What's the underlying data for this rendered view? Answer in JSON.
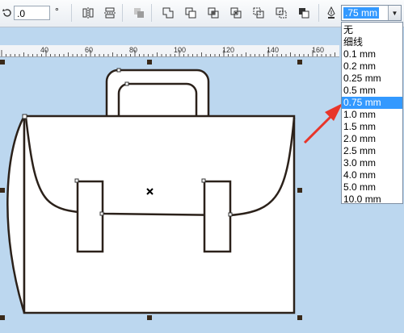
{
  "toolbar": {
    "angle_value": ".0",
    "angle_unit": "°",
    "outline_width_value": ".75 mm"
  },
  "ruler": {
    "ticks": [
      "40",
      "60",
      "80",
      "100",
      "120",
      "140",
      "160"
    ]
  },
  "outline_width_options": [
    "无",
    "细线",
    "0.1 mm",
    "0.2 mm",
    "0.25 mm",
    "0.5 mm",
    "0.75 mm",
    "1.0 mm",
    "1.5 mm",
    "2.0 mm",
    "2.5 mm",
    "3.0 mm",
    "4.0 mm",
    "5.0 mm",
    "10.0 mm"
  ],
  "selected_option": "0.75 mm",
  "colors": {
    "canvas_bg": "#bcd7ef",
    "selection_blue": "#3399ff",
    "annotation_arrow": "#e8352a",
    "outline": "#2b211a"
  },
  "icons": {
    "rotate": "rotate-icon",
    "outline_pen": "pen-icon"
  }
}
